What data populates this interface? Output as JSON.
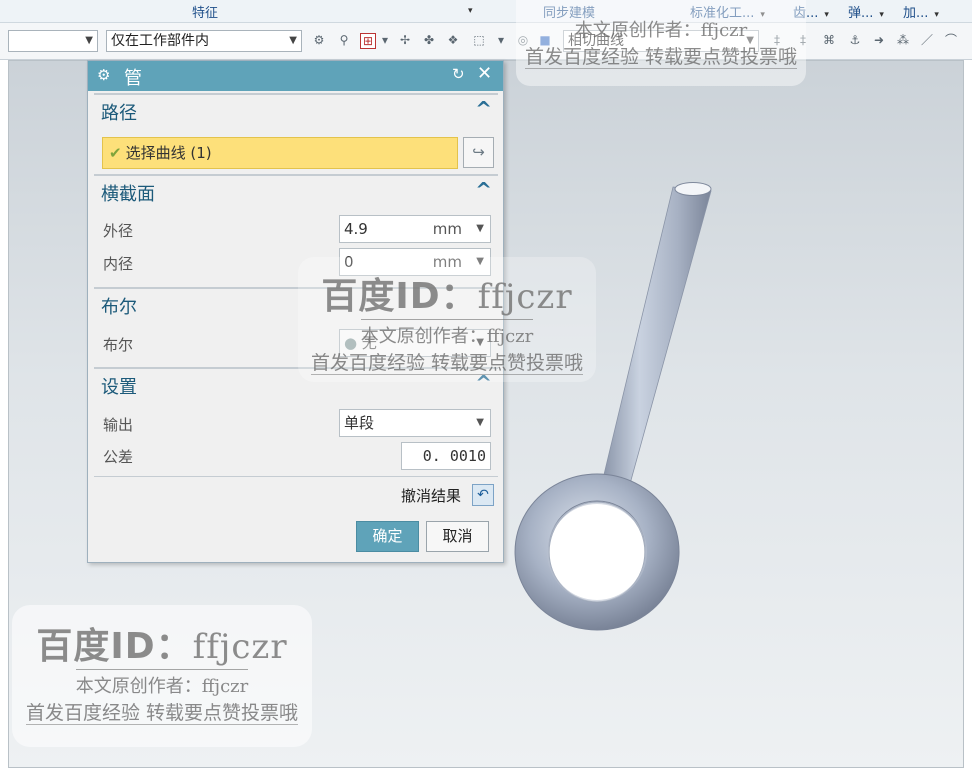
{
  "ribbon": {
    "tabs": [
      {
        "label": "特征",
        "dropdown": true
      },
      {
        "label": "同步建模",
        "dropdown": false
      },
      {
        "label": "标准化工...",
        "dropdown": true
      },
      {
        "label": "齿...",
        "dropdown": true
      },
      {
        "label": "弹...",
        "dropdown": true
      },
      {
        "label": "加...",
        "dropdown": true
      }
    ]
  },
  "toolbar": {
    "filter_combo": "",
    "scope_combo": "仅在工作部件内",
    "curve_rule_combo": "相切曲线"
  },
  "dialog": {
    "title": "管",
    "path": {
      "title": "路径",
      "select_curve": "选择曲线 (1)"
    },
    "cross_section": {
      "title": "横截面",
      "outer_label": "外径",
      "outer_value": "4.9",
      "outer_unit": "mm",
      "inner_label": "内径",
      "inner_value": "0",
      "inner_unit": "mm"
    },
    "boolean": {
      "title": "布尔",
      "label": "布尔",
      "value": "无"
    },
    "settings": {
      "title": "设置",
      "output_label": "输出",
      "output_value": "单段",
      "tolerance_label": "公差",
      "tolerance_value": "0. 0010"
    },
    "undo_label": "撤消结果",
    "ok_label": "确定",
    "cancel_label": "取消"
  },
  "watermark": {
    "id_line": "百度ID：",
    "id_name": "ffjczr",
    "author_line": "本文原创作者：ffjczr",
    "notice_line": "首发百度经验 转载要点赞投票哦"
  },
  "colors": {
    "dialog_title_bg": "#5fa3b9",
    "selection_highlight": "#fde07a",
    "model_color": "#aab4c6"
  }
}
